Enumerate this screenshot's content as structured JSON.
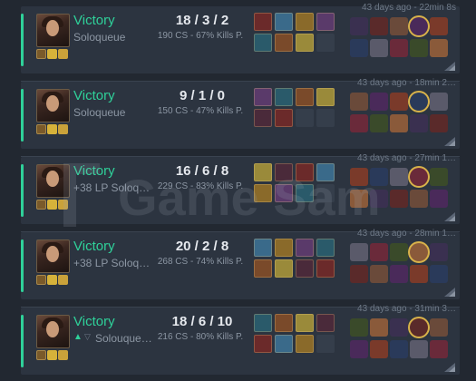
{
  "matches": [
    {
      "result": "Victory",
      "queue": "Soloqueue",
      "kda": "18 / 3 / 2",
      "cs": "190 CS - 67% Kills P.",
      "date": "43 days ago - 22min 8s",
      "show_arrows": false
    },
    {
      "result": "Victory",
      "queue": "Soloqueue",
      "kda": "9 / 1 / 0",
      "cs": "150 CS - 47% Kills P.",
      "date": "43 days ago - 18min 2…",
      "show_arrows": false
    },
    {
      "result": "Victory",
      "queue": "+38 LP Soloq…",
      "kda": "16 / 6 / 8",
      "cs": "229 CS - 83% Kills P.",
      "date": "43 days ago - 27min 1…",
      "show_arrows": false
    },
    {
      "result": "Victory",
      "queue": "+38 LP Soloq…",
      "kda": "20 / 2 / 8",
      "cs": "268 CS - 74% Kills P.",
      "date": "43 days ago - 28min 1…",
      "show_arrows": false
    },
    {
      "result": "Victory",
      "queue": "Solouque…",
      "kda": "18 / 6 / 10",
      "cs": "216 CS - 80% Kills P.",
      "date": "43 days ago - 31min 3…",
      "show_arrows": true
    }
  ],
  "arrow_up": "▲",
  "arrow_down": "▽",
  "colors": {
    "victory": "#2fd19a",
    "card_bg": "#2c3440",
    "page_bg": "#222831"
  },
  "icons": {
    "champion": "champion-portrait-icon",
    "spell": "summoner-spell-icon",
    "item": "item-icon",
    "ally": "ally-champion-icon",
    "expand": "expand-corner-icon"
  }
}
